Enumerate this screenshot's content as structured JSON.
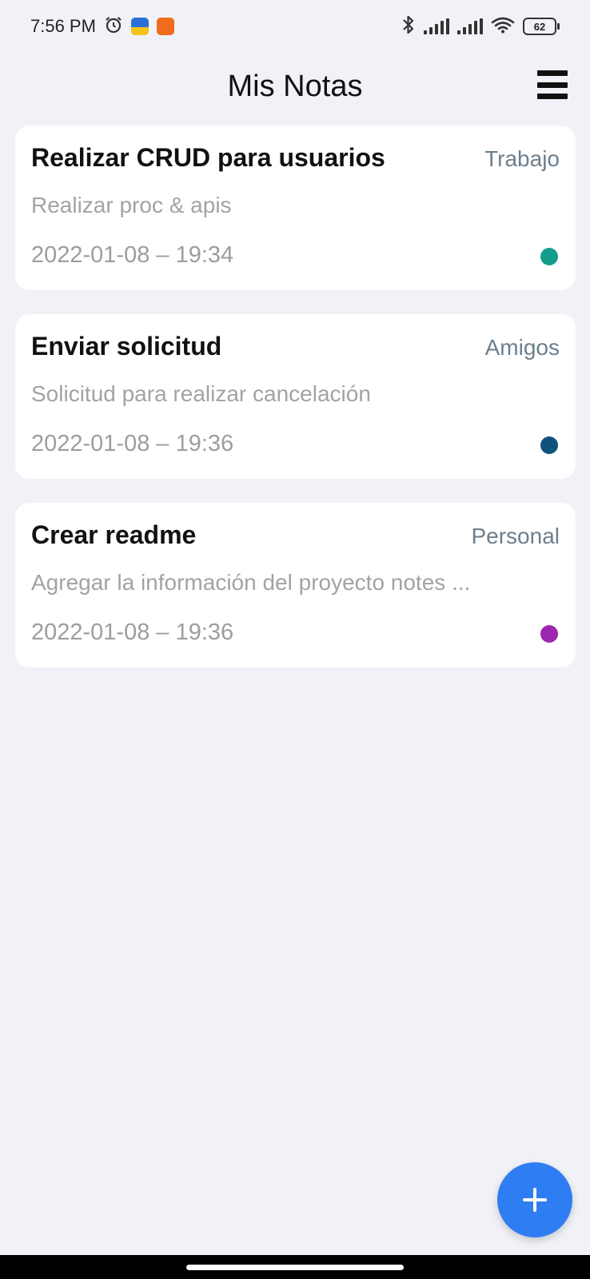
{
  "status_bar": {
    "time": "7:56 PM",
    "battery": "62",
    "icons": [
      "alarm-icon",
      "app-badge-blue",
      "app-badge-orange",
      "bluetooth-icon",
      "signal-icon",
      "signal-icon",
      "wifi-icon",
      "battery-icon"
    ]
  },
  "header": {
    "title": "Mis Notas",
    "menu_icon": "hamburger-menu-icon"
  },
  "notes": [
    {
      "title": "Realizar CRUD para usuarios",
      "category": "Trabajo",
      "description": "Realizar proc & apis",
      "date": "2022-01-08 – 19:34",
      "color": "#129e8a"
    },
    {
      "title": "Enviar solicitud",
      "category": "Amigos",
      "description": "Solicitud para realizar cancelación",
      "date": "2022-01-08 – 19:36",
      "color": "#0e537c"
    },
    {
      "title": "Crear readme",
      "category": "Personal",
      "description": "Agregar la información del proyecto notes ...",
      "date": "2022-01-08 – 19:36",
      "color": "#9c27b0"
    }
  ],
  "fab": {
    "icon": "plus-icon"
  },
  "colors": {
    "background": "#f0f2f7",
    "card": "#ffffff",
    "accent": "#2f7df2",
    "category_text": "#6c7f8c",
    "muted_text": "#a3a3a6"
  }
}
